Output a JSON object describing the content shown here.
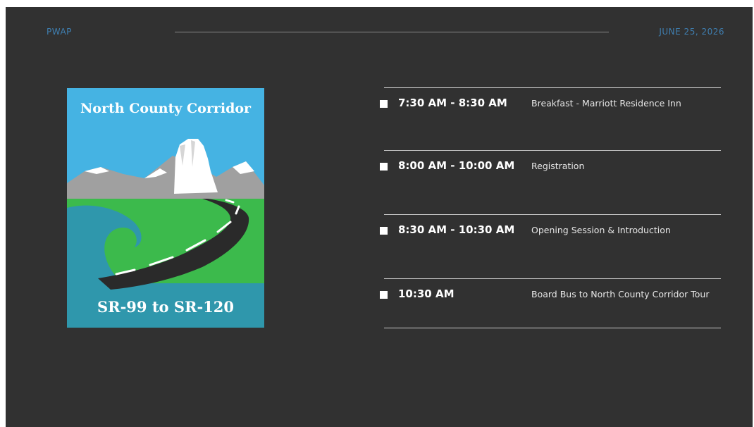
{
  "header": {
    "left_label": "PWAP",
    "date": "JUNE 25, 2026"
  },
  "logo": {
    "title": "North County Corridor",
    "subtitle": "SR-99 to SR-120",
    "colors": {
      "sky": "#45b3e3",
      "mountain_gray": "#a0a0a0",
      "snow": "#ffffff",
      "grass": "#3cba4c",
      "water": "#2f97ac",
      "road": "#2a2a2a"
    }
  },
  "colors": {
    "background": "#313131",
    "accent": "#3f7fb1",
    "text": "#ffffff"
  },
  "agenda": [
    {
      "time": "7:30 AM - 8:30 AM",
      "description": "Breakfast - Marriott Residence Inn"
    },
    {
      "time": "8:00 AM - 10:00 AM",
      "description": "Registration"
    },
    {
      "time": "8:30 AM - 10:30 AM",
      "description": "Opening Session & Introduction"
    },
    {
      "time": "10:30 AM",
      "description": "Board Bus to North County Corridor Tour"
    }
  ]
}
